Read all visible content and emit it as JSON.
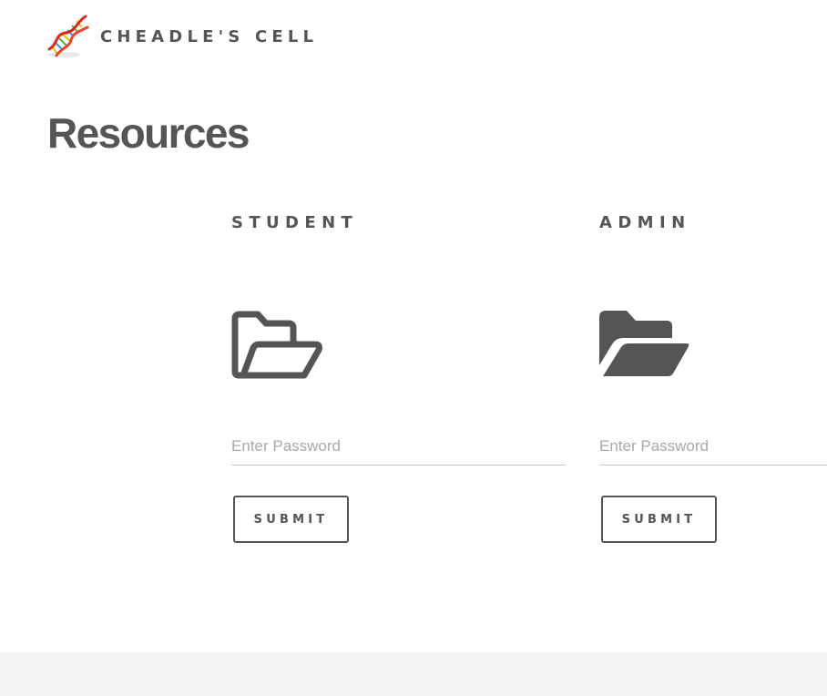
{
  "header": {
    "brand_name": "CHEADLE'S CELL",
    "logo_icon": "dna-helix-icon"
  },
  "page": {
    "title": "Resources"
  },
  "resources": [
    {
      "heading": "STUDENT",
      "icon": "folder-open-outline-icon",
      "password_placeholder": "Enter Password",
      "password_value": "",
      "submit_label": "SUBMIT"
    },
    {
      "heading": "ADMIN",
      "icon": "folder-open-solid-icon",
      "password_placeholder": "Enter Password",
      "password_value": "",
      "submit_label": "SUBMIT"
    }
  ],
  "colors": {
    "text": "#555555",
    "placeholder": "#a8a8a8",
    "footer_bg": "#f4f4f4"
  }
}
